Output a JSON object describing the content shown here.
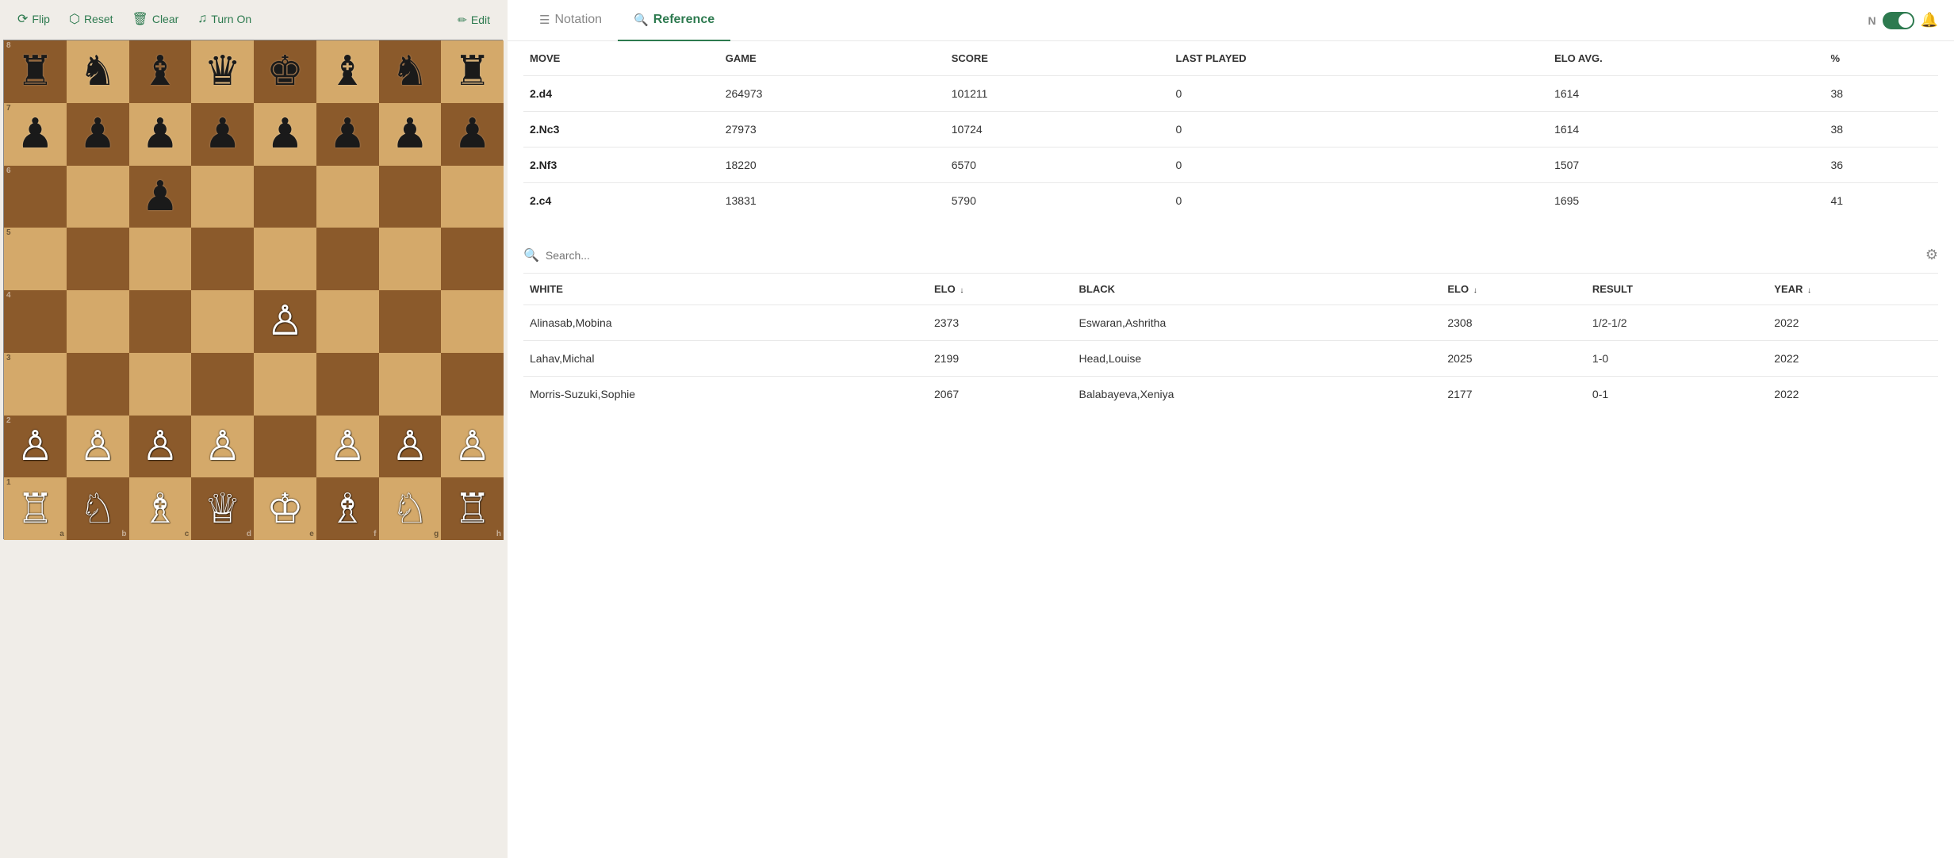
{
  "toolbar": {
    "flip_label": "Flip",
    "reset_label": "Reset",
    "clear_label": "Clear",
    "turnon_label": "Turn On",
    "edit_label": "Edit"
  },
  "tabs": {
    "notation_label": "Notation",
    "reference_label": "Reference",
    "active": "reference"
  },
  "n_label": "N",
  "moves": {
    "headers": {
      "move": "MOVE",
      "game": "GAME",
      "score": "SCORE",
      "last_played": "LAST PLAYED",
      "elo_avg": "ELO AVG.",
      "percent": "%"
    },
    "rows": [
      {
        "move": "2.d4",
        "game": "264973",
        "score": "101211",
        "last_played": "0",
        "elo_avg": "1614",
        "percent": "38"
      },
      {
        "move": "2.Nc3",
        "game": "27973",
        "score": "10724",
        "last_played": "0",
        "elo_avg": "1614",
        "percent": "38"
      },
      {
        "move": "2.Nf3",
        "game": "18220",
        "score": "6570",
        "last_played": "0",
        "elo_avg": "1507",
        "percent": "36"
      },
      {
        "move": "2.c4",
        "game": "13831",
        "score": "5790",
        "last_played": "0",
        "elo_avg": "1695",
        "percent": "41"
      }
    ]
  },
  "search": {
    "placeholder": "Search..."
  },
  "games": {
    "headers": {
      "white": "WHITE",
      "elo_white": "ELO",
      "black": "BLACK",
      "elo_black": "ELO",
      "result": "RESULT",
      "year": "YEAR"
    },
    "rows": [
      {
        "white": "Alinasab,Mobina",
        "elo_white": "2373",
        "black": "Eswaran,Ashritha",
        "elo_black": "2308",
        "result": "1/2-1/2",
        "year": "2022"
      },
      {
        "white": "Lahav,Michal",
        "elo_white": "2199",
        "black": "Head,Louise",
        "elo_black": "2025",
        "result": "1-0",
        "year": "2022"
      },
      {
        "white": "Morris-Suzuki,Sophie",
        "elo_white": "2067",
        "black": "Balabayeva,Xeniya",
        "elo_black": "2177",
        "result": "0-1",
        "year": "2022"
      }
    ]
  },
  "board": {
    "pieces": [
      [
        "♜",
        "♞",
        "♝",
        "♛",
        "♚",
        "♝",
        "♞",
        "♜"
      ],
      [
        "♟",
        "♟",
        "♟",
        "♟",
        "♟",
        "♟",
        "♟",
        "♟"
      ],
      [
        "",
        "",
        "♟",
        "",
        "",
        "",
        "",
        ""
      ],
      [
        "",
        "",
        "",
        "",
        "",
        "",
        "",
        ""
      ],
      [
        "",
        "",
        "",
        "",
        "♙",
        "",
        "",
        ""
      ],
      [
        "",
        "",
        "",
        "",
        "",
        "",
        "",
        ""
      ],
      [
        "♙",
        "♙",
        "♙",
        "♙",
        "",
        "♙",
        "♙",
        "♙"
      ],
      [
        "♖",
        "♘",
        "♗",
        "♕",
        "♔",
        "♗",
        "♘",
        "♖"
      ]
    ],
    "ranks": [
      "8",
      "7",
      "6",
      "5",
      "4",
      "3",
      "2",
      "1"
    ],
    "files": [
      "a",
      "b",
      "c",
      "d",
      "e",
      "f",
      "g",
      "h"
    ]
  }
}
